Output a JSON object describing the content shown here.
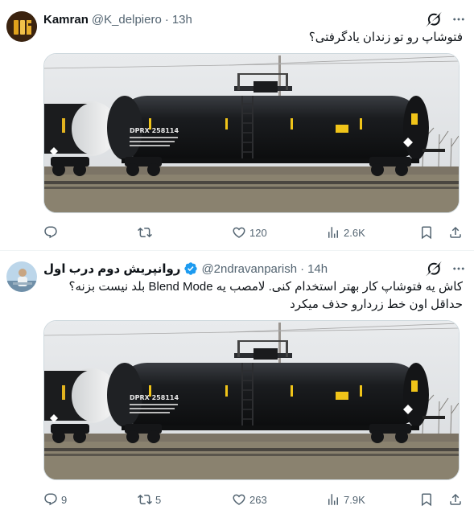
{
  "tweets": [
    {
      "author_name": "Kamran",
      "handle": "@K_delpiero",
      "separator": "·",
      "time": "13h",
      "verified": false,
      "text_lines": [
        "فتوشاپ رو تو زندان یادگرفتی؟"
      ],
      "image": {
        "car_number": "DPRX 258114"
      },
      "replies": "",
      "retweets": "",
      "likes": "120",
      "views": "2.6K"
    },
    {
      "author_name": "روانپریش دوم درب اول",
      "handle": "@2ndravanparish",
      "separator": "·",
      "time": "14h",
      "verified": true,
      "text_lines": [
        "کاش یه فتوشاپ کار بهتر استخدام کنی. لامصب یه Blend Mode بلد نیست بزنه؟",
        "حداقل اون خط زردارو حذف میکرد"
      ],
      "image": {
        "car_number": "DPRX 258114"
      },
      "replies": "9",
      "retweets": "5",
      "likes": "263",
      "views": "7.9K"
    }
  ],
  "colors": {
    "text": "#0f1419",
    "secondary": "#536471",
    "verified": "#1d9bf0",
    "divider": "#eff3f4"
  }
}
